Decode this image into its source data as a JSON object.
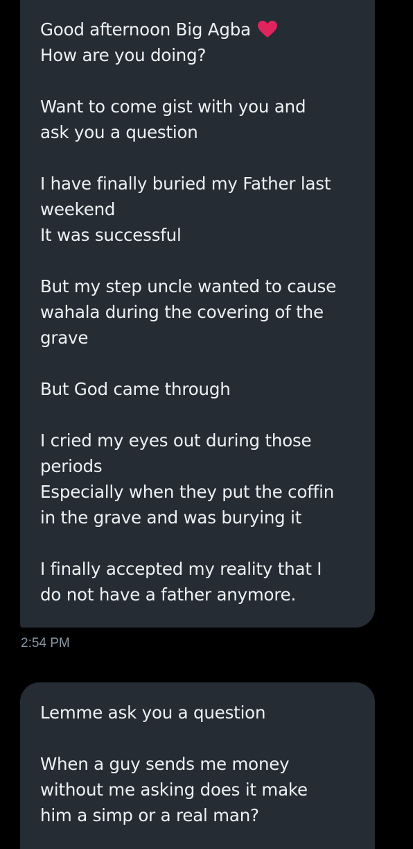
{
  "messages": [
    {
      "lines": [
        "Good afternoon Big Agba",
        "How are you doing?",
        "",
        "Want to come gist with you and",
        "ask you a question",
        "",
        "I have finally buried my Father last",
        "weekend",
        "It was successful",
        "",
        "But my step uncle wanted to cause",
        "wahala during the covering of the",
        "grave",
        "",
        "But God came through",
        "",
        "I cried my eyes out during those",
        "periods",
        "Especially when they put the coffin",
        "in the grave and was burying it",
        "",
        "I finally accepted my reality that I",
        "do not have a father anymore."
      ],
      "emoji": "heart-icon",
      "timestamp": "2:54 PM"
    },
    {
      "lines": [
        "Lemme ask you a question",
        "",
        "When a guy sends me money",
        "without me asking does it make",
        "him a simp or a real man?"
      ]
    }
  ],
  "colors": {
    "background": "#000000",
    "bubble": "#252c33",
    "text": "#eef1f4",
    "timestamp": "#8b98a5",
    "heart": "#e0245e"
  }
}
